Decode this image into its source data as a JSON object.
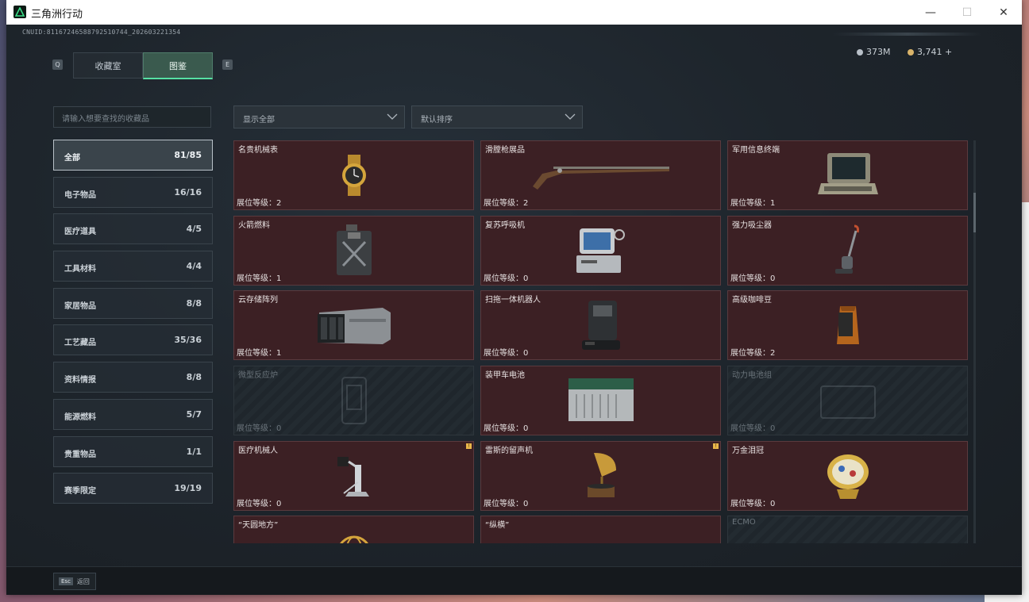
{
  "window": {
    "title": "三角洲行动"
  },
  "header": {
    "uid": "CNUID:81167246588792510744_202603221354",
    "key_left": "Q",
    "key_right": "E",
    "tabs": [
      {
        "label": "收藏室",
        "active": false
      },
      {
        "label": "图鉴",
        "active": true
      }
    ],
    "currency_silver": "373M",
    "currency_gold": "3,741 +"
  },
  "search": {
    "placeholder": "请输入想要查找的收藏品"
  },
  "filters": {
    "display": "显示全部",
    "sort": "默认排序"
  },
  "categories": [
    {
      "name": "全部",
      "count": "81/85",
      "active": true
    },
    {
      "name": "电子物品",
      "count": "16/16"
    },
    {
      "name": "医疗道具",
      "count": "4/5"
    },
    {
      "name": "工具材料",
      "count": "4/4"
    },
    {
      "name": "家居物品",
      "count": "8/8"
    },
    {
      "name": "工艺藏品",
      "count": "35/36"
    },
    {
      "name": "资料情报",
      "count": "8/8"
    },
    {
      "name": "能源燃料",
      "count": "5/7"
    },
    {
      "name": "贵重物品",
      "count": "1/1"
    },
    {
      "name": "赛季限定",
      "count": "19/19"
    }
  ],
  "items": [
    {
      "name": "名贵机械表",
      "level": "展位等级：2",
      "icon": "watch-icon",
      "locked": false
    },
    {
      "name": "滑膛枪展品",
      "level": "展位等级：2",
      "icon": "musket-icon",
      "locked": false
    },
    {
      "name": "军用信息终端",
      "level": "展位等级：1",
      "icon": "terminal-icon",
      "locked": false
    },
    {
      "name": "火箭燃料",
      "level": "展位等级：1",
      "icon": "fuel-can-icon",
      "locked": false
    },
    {
      "name": "复苏呼吸机",
      "level": "展位等级：0",
      "icon": "ventilator-icon",
      "locked": false
    },
    {
      "name": "强力吸尘器",
      "level": "展位等级：0",
      "icon": "vacuum-icon",
      "locked": false
    },
    {
      "name": "云存储阵列",
      "level": "展位等级：1",
      "icon": "storage-array-icon",
      "locked": false
    },
    {
      "name": "扫拖一体机器人",
      "level": "展位等级：0",
      "icon": "robot-icon",
      "locked": false
    },
    {
      "name": "高级咖啡豆",
      "level": "展位等级：2",
      "icon": "coffee-bag-icon",
      "locked": false
    },
    {
      "name": "微型反应炉",
      "level": "展位等级：0",
      "icon": "reactor-icon",
      "locked": true
    },
    {
      "name": "装甲车电池",
      "level": "展位等级：0",
      "icon": "battery-icon",
      "locked": false
    },
    {
      "name": "动力电池组",
      "level": "展位等级：0",
      "icon": "battery-pack-icon",
      "locked": true
    },
    {
      "name": "医疗机械人",
      "level": "展位等级：0",
      "icon": "medical-robot-icon",
      "locked": false,
      "mark": "!"
    },
    {
      "name": "雷斯的留声机",
      "level": "展位等级：0",
      "icon": "gramophone-icon",
      "locked": false,
      "mark": "!"
    },
    {
      "name": "万金泪冠",
      "level": "展位等级：0",
      "icon": "jewel-egg-icon",
      "locked": false
    },
    {
      "name": "“天圆地方”",
      "level": "",
      "icon": "globe-icon",
      "locked": false
    },
    {
      "name": "“纵横”",
      "level": "",
      "icon": "board-icon",
      "locked": false
    },
    {
      "name": "ECMO",
      "level": "",
      "icon": "ecmo-icon",
      "locked": true
    }
  ],
  "footer": {
    "esc_key": "Esc",
    "back_label": "返回"
  }
}
